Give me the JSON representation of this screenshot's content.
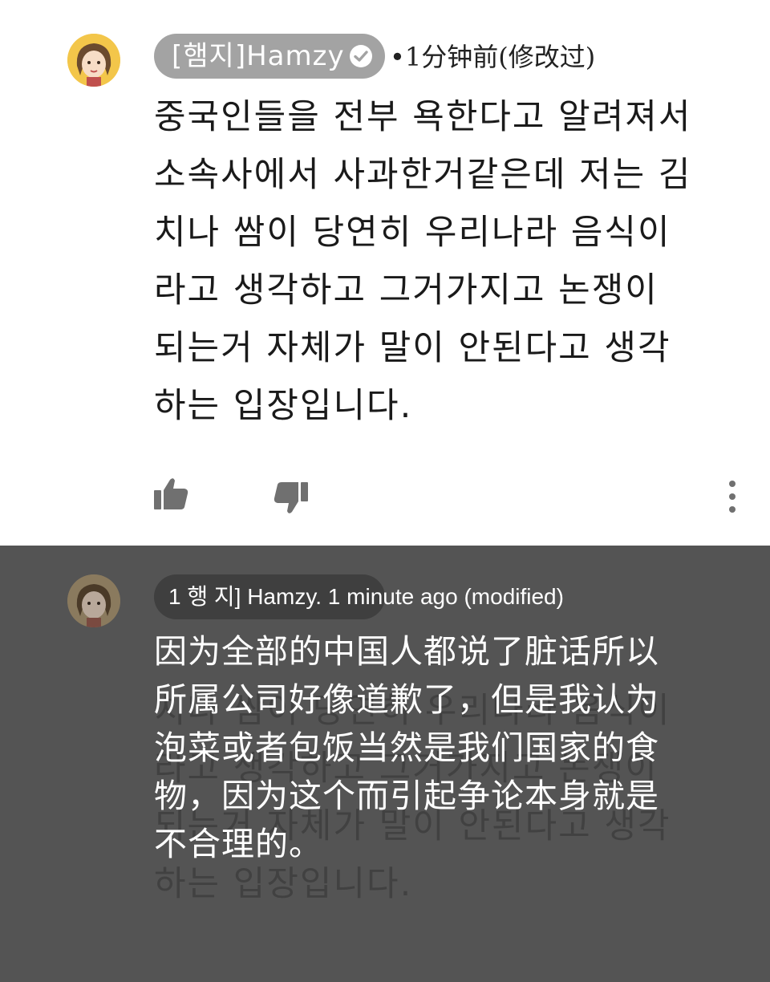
{
  "original_comment": {
    "author": "[햄지]Hamzy",
    "meta": "•1分钟前(修改过)",
    "text_lines": [
      "중국인들을 전부 욕한다고 알려져서",
      "소속사에서 사과한거같은데 저는 김",
      "치나 쌈이 당연히 우리나라 음식이",
      "라고 생각하고 그거가지고 논쟁이",
      "되는거 자체가 말이 안된다고 생각",
      "하는 입장입니다."
    ],
    "icons": [
      "like-icon",
      "dislike-icon",
      "more-vert-icon",
      "verified-icon"
    ]
  },
  "translated_comment": {
    "meta": "1 행 지] Hamzy. 1 minute ago (modified)",
    "text_lines": [
      "因为全部的中国人都说了脏话所以",
      "所属公司好像道歉了，但是我认为",
      "泡菜或者包饭当然是我们国家的食",
      "物，因为这个而引起争论本身就是",
      "不合理的。"
    ],
    "ghost_lines": [
      "",
      "",
      "치나 쌈이 당연히 우리나라 음식이",
      "라고 생각하고 그거가지고 논쟁이",
      "되는거 자체가 말이 안된다고 생각",
      "하는 입장입니다."
    ]
  },
  "colors": {
    "overlay_bg": "#545454",
    "author_pill": "#a3a3a3",
    "avatar_bg": "#f3c64a"
  }
}
